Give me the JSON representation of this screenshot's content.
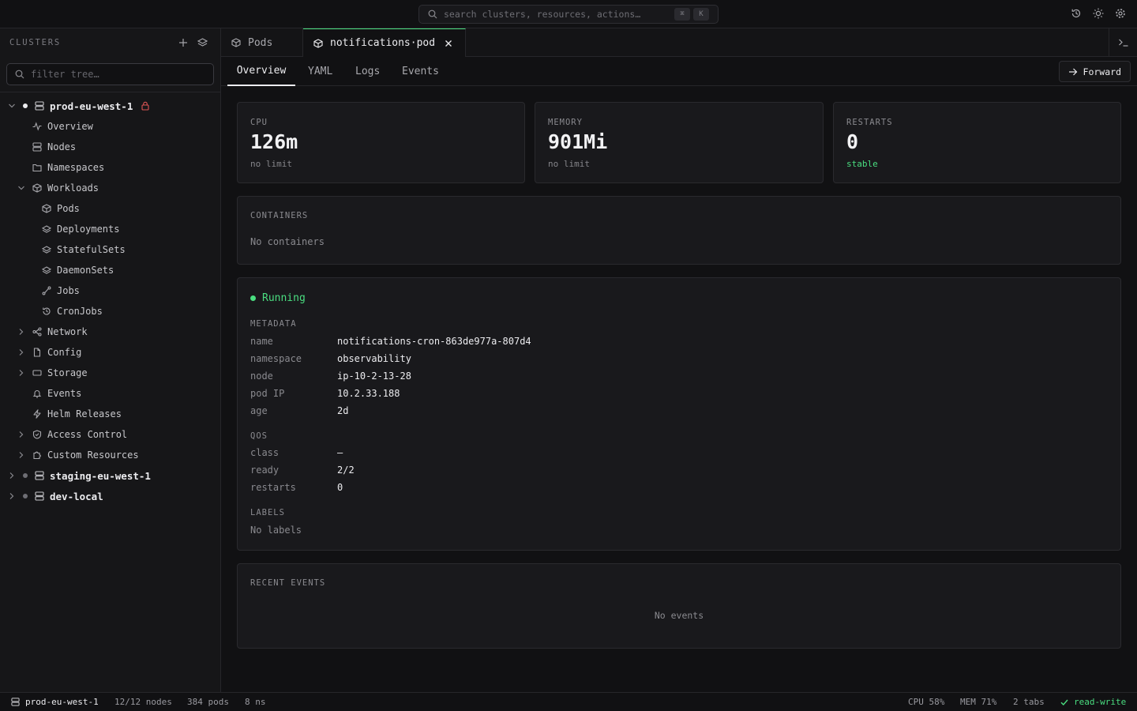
{
  "topbar": {
    "search_placeholder": "search clusters, resources, actions…",
    "kbd_cmd": "⌘",
    "kbd_key": "K"
  },
  "sidebar": {
    "title": "CLUSTERS",
    "filter_placeholder": "filter tree…",
    "clusters": [
      {
        "name": "prod-eu-west-1",
        "items": {
          "overview": "Overview",
          "nodes": "Nodes",
          "namespaces": "Namespaces",
          "workloads": "Workloads",
          "pods": "Pods",
          "deployments": "Deployments",
          "statefulsets": "StatefulSets",
          "daemonsets": "DaemonSets",
          "jobs": "Jobs",
          "cronjobs": "CronJobs",
          "network": "Network",
          "config": "Config",
          "storage": "Storage",
          "events": "Events",
          "helm": "Helm Releases",
          "access": "Access Control",
          "custom": "Custom Resources"
        }
      },
      {
        "name": "staging-eu-west-1"
      },
      {
        "name": "dev-local"
      }
    ]
  },
  "tabs": [
    {
      "label": "Pods"
    },
    {
      "label": "notifications·pod"
    }
  ],
  "subtabs": [
    "Overview",
    "YAML",
    "Logs",
    "Events"
  ],
  "forward_label": "Forward",
  "stats": [
    {
      "caption": "CPU",
      "value": "126m",
      "sub": "no limit"
    },
    {
      "caption": "MEMORY",
      "value": "901Mi",
      "sub": "no limit"
    },
    {
      "caption": "RESTARTS",
      "value": "0",
      "sub": "stable"
    }
  ],
  "containers": {
    "caption": "CONTAINERS",
    "empty": "No containers"
  },
  "detail": {
    "status": "Running",
    "metadata_caption": "METADATA",
    "metadata": [
      {
        "k": "name",
        "v": "notifications-cron-863de977a-807d4"
      },
      {
        "k": "namespace",
        "v": "observability"
      },
      {
        "k": "node",
        "v": "ip-10-2-13-28"
      },
      {
        "k": "pod IP",
        "v": "10.2.33.188"
      },
      {
        "k": "age",
        "v": "2d"
      }
    ],
    "qos_caption": "QOS",
    "qos": [
      {
        "k": "class",
        "v": "—"
      },
      {
        "k": "ready",
        "v": "2/2"
      },
      {
        "k": "restarts",
        "v": "0"
      }
    ],
    "labels_caption": "LABELS",
    "labels_empty": "No labels"
  },
  "events": {
    "caption": "RECENT EVENTS",
    "empty": "No events"
  },
  "statusbar": {
    "cluster": "prod-eu-west-1",
    "nodes": "12/12 nodes",
    "pods": "384 pods",
    "ns": "8 ns",
    "cpu": "CPU 58%",
    "mem": "MEM 71%",
    "tabs": "2 tabs",
    "mode": "read-write"
  },
  "colors": {
    "accent": "#4ade80",
    "status_running": "#4ade80",
    "locked": "#e05555",
    "background": "#111113"
  }
}
